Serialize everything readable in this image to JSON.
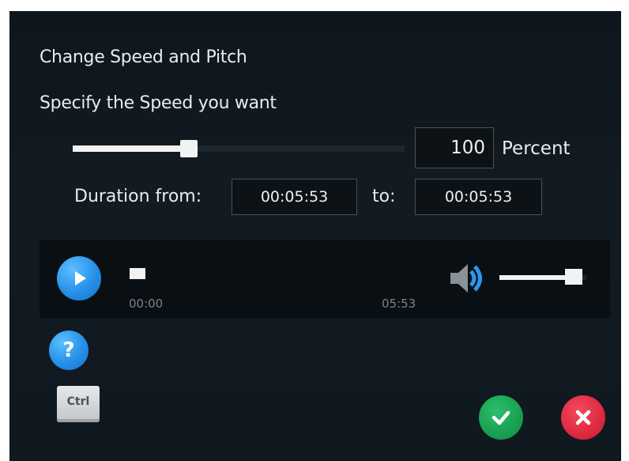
{
  "dialog": {
    "title": "Change Speed and Pitch",
    "subtitle": "Specify the Speed you want"
  },
  "speed": {
    "slider_value_fraction": 0.35,
    "value": "100",
    "unit": "Percent"
  },
  "duration": {
    "label": "Duration from:",
    "from": "00:05:53",
    "to_label": "to:",
    "to": "00:05:53"
  },
  "player": {
    "current_time": "00:00",
    "total_time": "05:53",
    "progress_fraction": 0.0,
    "volume_fraction": 0.85
  },
  "buttons": {
    "help_glyph": "?",
    "ctrl_key": "Ctrl"
  },
  "icons": {
    "play": "play-icon",
    "speaker": "speaker-icon",
    "help": "help-icon",
    "ok": "checkmark-icon",
    "cancel": "close-icon"
  },
  "colors": {
    "background": "#121a22",
    "play_blue": "#2590e8",
    "ok_green": "#19a052",
    "cancel_red": "#dd2a40"
  }
}
